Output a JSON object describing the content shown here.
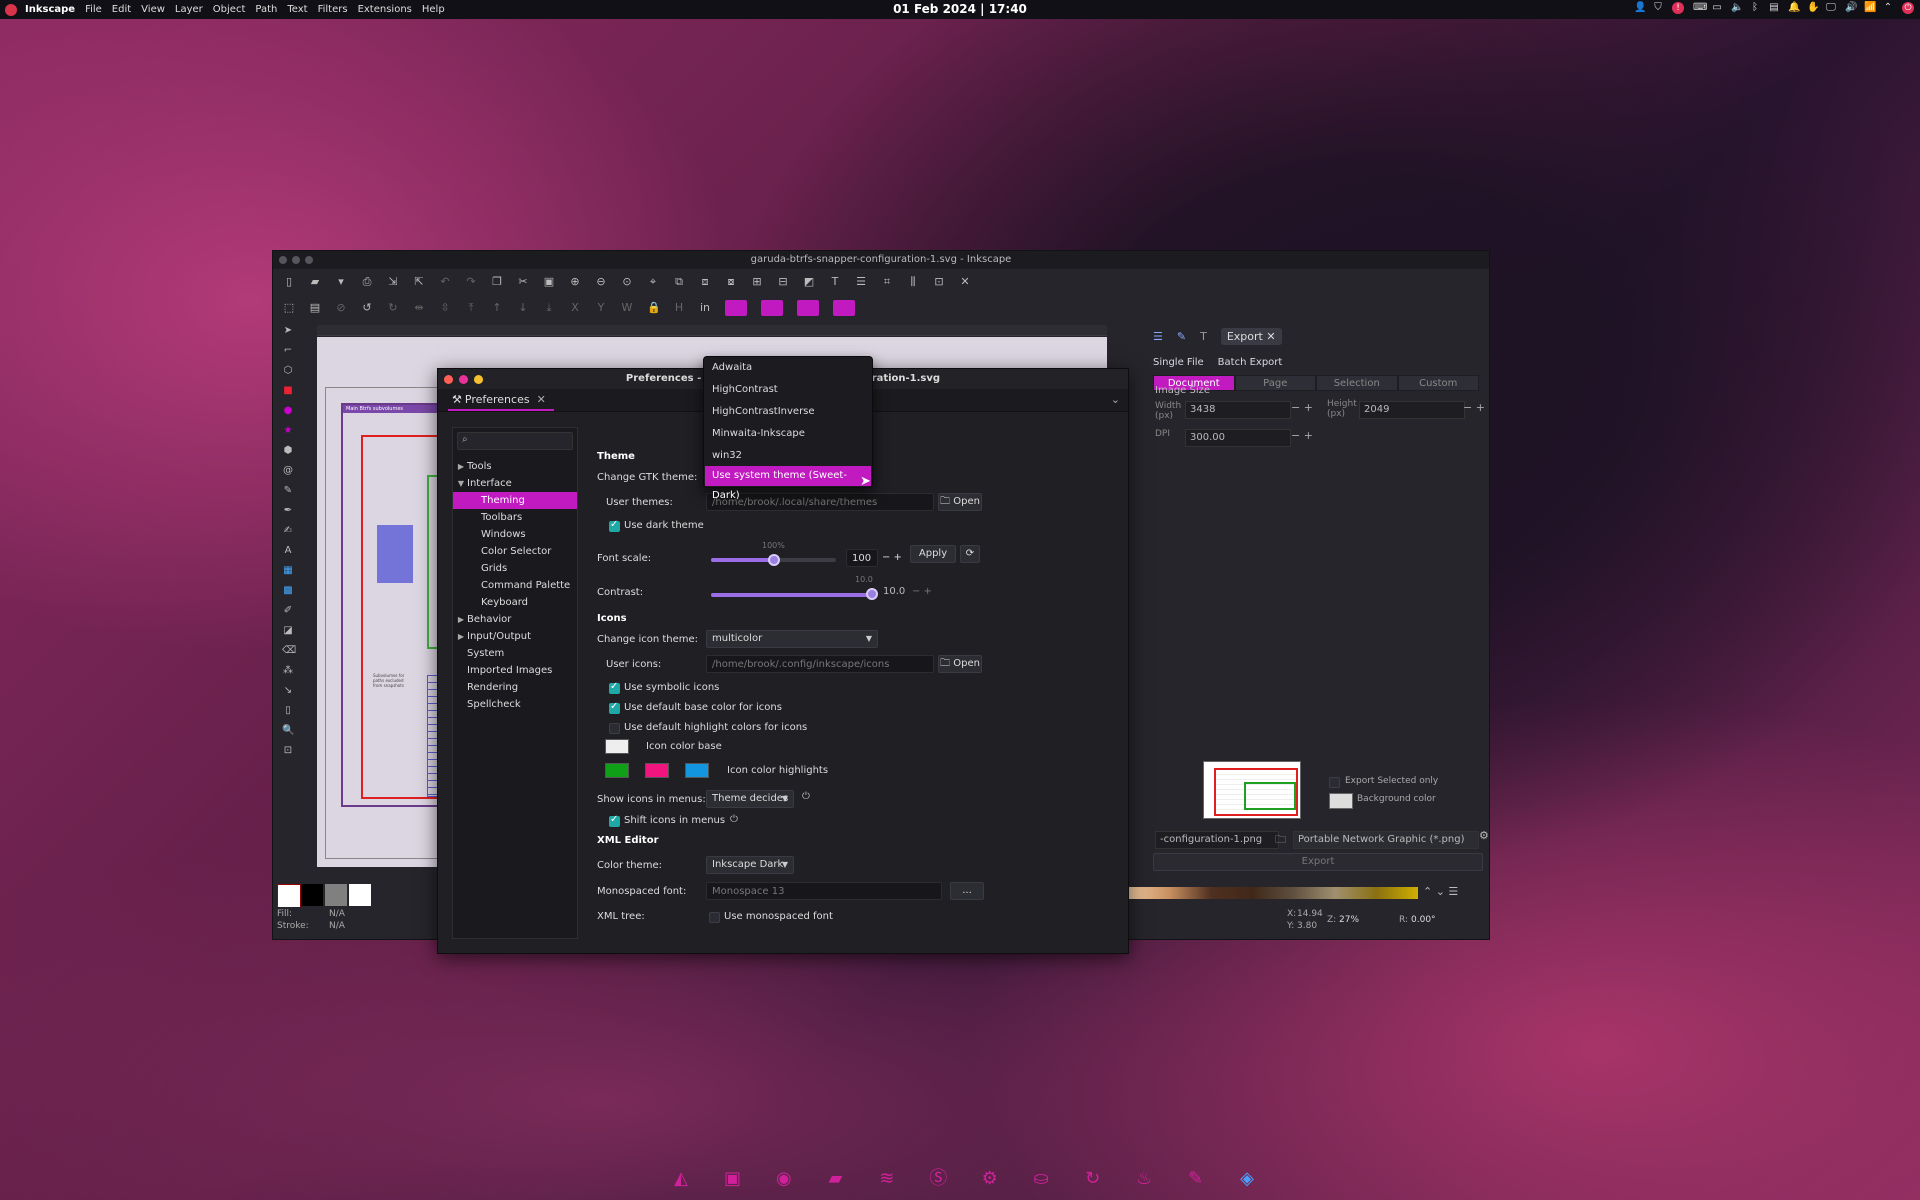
{
  "topbar": {
    "app": "Inkscape",
    "menus": [
      "File",
      "Edit",
      "View",
      "Layer",
      "Object",
      "Path",
      "Text",
      "Filters",
      "Extensions",
      "Help"
    ],
    "clock": "01 Feb 2024 | 17:40"
  },
  "inkscape": {
    "title": "garuda-btrfs-snapper-configuration-1.svg - Inkscape",
    "unit": "in",
    "status": {
      "fill_label": "Fill:",
      "fill_value": "N/A",
      "stroke_label": "Stroke:",
      "stroke_value": "N/A",
      "x_label": "X:",
      "x": "14.94",
      "y_label": "Y:",
      "y": "3.80",
      "zoom_label": "Z:",
      "zoom": "27%",
      "rot_label": "R:",
      "rotation": "0.00°"
    },
    "canvas": {
      "heading": "Main Btrfs subvolumes",
      "note": "Subvolumes for paths excluded from snapshots"
    }
  },
  "export": {
    "tab": "Export",
    "modes": [
      "Single File",
      "Batch Export"
    ],
    "areas": [
      "Document",
      "Page",
      "Selection",
      "Custom"
    ],
    "active_area": "Document",
    "image_size_label": "Image Size",
    "width_label": "Width (px)",
    "width": "3438",
    "height_label": "Height (px)",
    "height": "2049",
    "dpi_label": "DPI",
    "dpi": "300.00",
    "export_selected_only": "Export Selected only",
    "background_color": "Background color",
    "filename": "-configuration-1.png",
    "format": "Portable Network Graphic (*.png)",
    "export_button": "Export"
  },
  "preferences": {
    "title": "Preferences - garuda-btrfs-snapper-configuration-1.svg",
    "tab": "Preferences",
    "tree": [
      {
        "label": "Tools",
        "level": 0,
        "arrow": "▶"
      },
      {
        "label": "Interface",
        "level": 0,
        "arrow": "▼"
      },
      {
        "label": "Theming",
        "level": 1,
        "selected": true
      },
      {
        "label": "Toolbars",
        "level": 1
      },
      {
        "label": "Windows",
        "level": 1
      },
      {
        "label": "Color Selector",
        "level": 1
      },
      {
        "label": "Grids",
        "level": 1
      },
      {
        "label": "Command Palette",
        "level": 1
      },
      {
        "label": "Keyboard",
        "level": 1
      },
      {
        "label": "Behavior",
        "level": 0,
        "arrow": "▶"
      },
      {
        "label": "Input/Output",
        "level": 0,
        "arrow": "▶"
      },
      {
        "label": "System",
        "level": 0
      },
      {
        "label": "Imported Images",
        "level": 0
      },
      {
        "label": "Rendering",
        "level": 0
      },
      {
        "label": "Spellcheck",
        "level": 0
      }
    ],
    "theme": {
      "header": "Theme",
      "gtk_label": "Change GTK theme:",
      "user_themes_label": "User themes:",
      "user_themes_path": "/home/brook/.local/share/themes",
      "open": "Open",
      "dark_theme": "Use dark theme",
      "font_scale_label": "Font scale:",
      "font_scale_mark": "100%",
      "font_scale_value": "100",
      "apply": "Apply",
      "contrast_label": "Contrast:",
      "contrast_mark": "10.0",
      "contrast_value": "10.0"
    },
    "icons": {
      "header": "Icons",
      "theme_label": "Change icon theme:",
      "theme_value": "multicolor",
      "user_icons_label": "User icons:",
      "user_icons_path": "/home/brook/.config/inkscape/icons",
      "open": "Open",
      "symbolic": "Use symbolic icons",
      "default_base": "Use default base color for icons",
      "default_highlight": "Use default highlight colors for icons",
      "base_label": "Icon color base",
      "highlights_label": "Icon color highlights",
      "show_in_menus_label": "Show icons in menus:",
      "show_in_menus_value": "Theme decides",
      "shift_icons": "Shift icons in menus"
    },
    "xml": {
      "header": "XML Editor",
      "color_theme_label": "Color theme:",
      "color_theme_value": "Inkscape Dark",
      "mono_font_label": "Monospaced font:",
      "mono_font_value": "Monospace 13",
      "mono_font_button": "...",
      "tree_label": "XML tree:",
      "use_mono": "Use monospaced font"
    },
    "gtk_popup": [
      "Adwaita",
      "HighContrast",
      "HighContrastInverse",
      "Minwaita-Inkscape",
      "win32",
      "Use system theme (Sweet-Dark)"
    ]
  },
  "colors": {
    "accent": "#c11ac0",
    "icon_base": "#eeeeee",
    "highlight1": "#10a018",
    "highlight2": "#f0147f",
    "highlight3": "#1396e0"
  }
}
